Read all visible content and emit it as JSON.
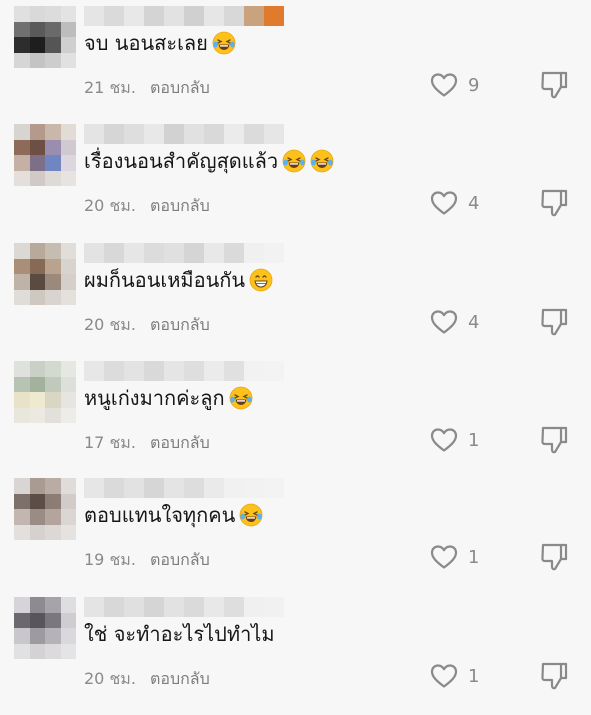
{
  "comments": [
    {
      "text": "จบ นอนสะเลย",
      "emojis": [
        "laughing-tears"
      ],
      "time": "21 ชม.",
      "reply_label": "ตอบกลับ",
      "likes": "9",
      "avatar_colors": [
        "#e0e0e0",
        "#d9d9d9",
        "#dcdcdc",
        "#e3e3e3",
        "#707070",
        "#5a5a5a",
        "#6a6a6a",
        "#bdbdbd",
        "#2d2d2d",
        "#1e1e1e",
        "#555555",
        "#cfcfcf",
        "#d6d6d6",
        "#c4c4c4",
        "#cdcdcd",
        "#e1e1e1"
      ],
      "username_colors": [
        "#e5e5e5",
        "#dadada",
        "#e8e8e8",
        "#d4d4d4",
        "#e2e2e2",
        "#d0d0d0",
        "#e6e6e6",
        "#d8d8d8",
        "#c9a27e",
        "#e07a2c"
      ]
    },
    {
      "text": "เรื่องนอนสำคัญสุดแล้ว",
      "emojis": [
        "laughing-tears",
        "laughing-tears"
      ],
      "time": "20 ชม.",
      "reply_label": "ตอบกลับ",
      "likes": "4",
      "avatar_colors": [
        "#d8d4d0",
        "#b39a8c",
        "#c9b7aa",
        "#e2dcd6",
        "#8e6a5b",
        "#6e4f44",
        "#9a8db0",
        "#d0c9cf",
        "#c4b0a4",
        "#7c6f86",
        "#6f86c2",
        "#dcd6df",
        "#e4dfdb",
        "#d1c9c5",
        "#dedad6",
        "#e6e3e0"
      ],
      "username_colors": [
        "#e4e4e4",
        "#d6d6d6",
        "#dedede",
        "#e8e8e8",
        "#d2d2d2",
        "#e1e1e1",
        "#d9d9d9",
        "#ebebeb",
        "#dbdbdb",
        "#e6e6e6"
      ]
    },
    {
      "text": "ผมก็นอนเหมือนกัน",
      "emojis": [
        "grinning"
      ],
      "time": "20 ชม.",
      "reply_label": "ตอบกลับ",
      "likes": "4",
      "avatar_colors": [
        "#dcd9d4",
        "#b8aa9a",
        "#c6bdb2",
        "#e1ddd9",
        "#a98f78",
        "#866a55",
        "#b9a38f",
        "#d8d3ce",
        "#bfb3a7",
        "#5b4a3f",
        "#9b8a7b",
        "#d4cfca",
        "#e0dcd8",
        "#cfc8c1",
        "#d9d4cf",
        "#e4e1dd"
      ],
      "username_colors": [
        "#e3e3e3",
        "#d8d8d8",
        "#e6e6e6",
        "#dcdcdc",
        "#e0e0e0",
        "#d5d5d5",
        "#e8e8e8",
        "#dadada",
        "#f0f0f0",
        "#f2f2f2"
      ]
    },
    {
      "text": "หนูเก่งมากค่ะลูก",
      "emojis": [
        "laughing-tears"
      ],
      "time": "17 ชม.",
      "reply_label": "ตอบกลับ",
      "likes": "1",
      "avatar_colors": [
        "#dfe2dc",
        "#c9d1c6",
        "#d4d9d0",
        "#e5e7e3",
        "#b8c4b3",
        "#a2b29c",
        "#c1c9bc",
        "#dde0da",
        "#e8e3c8",
        "#efe9cf",
        "#d9d6c4",
        "#e6e5e1",
        "#e9e6dc",
        "#ece9e0",
        "#e2e0da",
        "#eeece8"
      ],
      "username_colors": [
        "#e7e7e7",
        "#dcdcdc",
        "#e3e3e3",
        "#d9d9d9",
        "#e5e5e5",
        "#dedede",
        "#ebebeb",
        "#e0e0e0",
        "#f2f2f2",
        "#f3f3f3"
      ]
    },
    {
      "text": "ตอบแทนใจทุกคน",
      "emojis": [
        "laughing-tears"
      ],
      "time": "19 ชม.",
      "reply_label": "ตอบกลับ",
      "likes": "1",
      "avatar_colors": [
        "#d9d5d2",
        "#a99a92",
        "#b9aca5",
        "#e0dcd9",
        "#7d6f69",
        "#5c4d47",
        "#8c7c74",
        "#d2ccc8",
        "#c2b6b0",
        "#9a8b84",
        "#b3a59e",
        "#dbd6d3",
        "#e2dfdc",
        "#d6d1ce",
        "#dcd8d5",
        "#e5e2e0"
      ],
      "username_colors": [
        "#e6e6e6",
        "#dadada",
        "#e2e2e2",
        "#d6d6d6",
        "#e4e4e4",
        "#dddddd",
        "#eaeaea",
        "#f1f1f1",
        "#f2f2f2",
        "#f3f3f3"
      ]
    },
    {
      "text": "ใช่ จะทำอะไรไปทำไม",
      "emojis": [],
      "time": "20 ชม.",
      "reply_label": "ตอบกลับ",
      "likes": "1",
      "avatar_colors": [
        "#d6d4d8",
        "#8d8a92",
        "#a6a3aa",
        "#dedde0",
        "#6b6870",
        "#58555c",
        "#7a777f",
        "#cfcdd1",
        "#c9c7cb",
        "#9d9aa0",
        "#b5b3b8",
        "#dad8dc",
        "#e1e0e2",
        "#d4d2d5",
        "#dcdadd",
        "#e4e3e5"
      ],
      "username_colors": [
        "#e4e4e4",
        "#d8d8d8",
        "#e0e0e0",
        "#d5d5d5",
        "#e2e2e2",
        "#dadada",
        "#e8e8e8",
        "#dedede",
        "#f0f0f0",
        "#f1f1f1"
      ]
    }
  ]
}
